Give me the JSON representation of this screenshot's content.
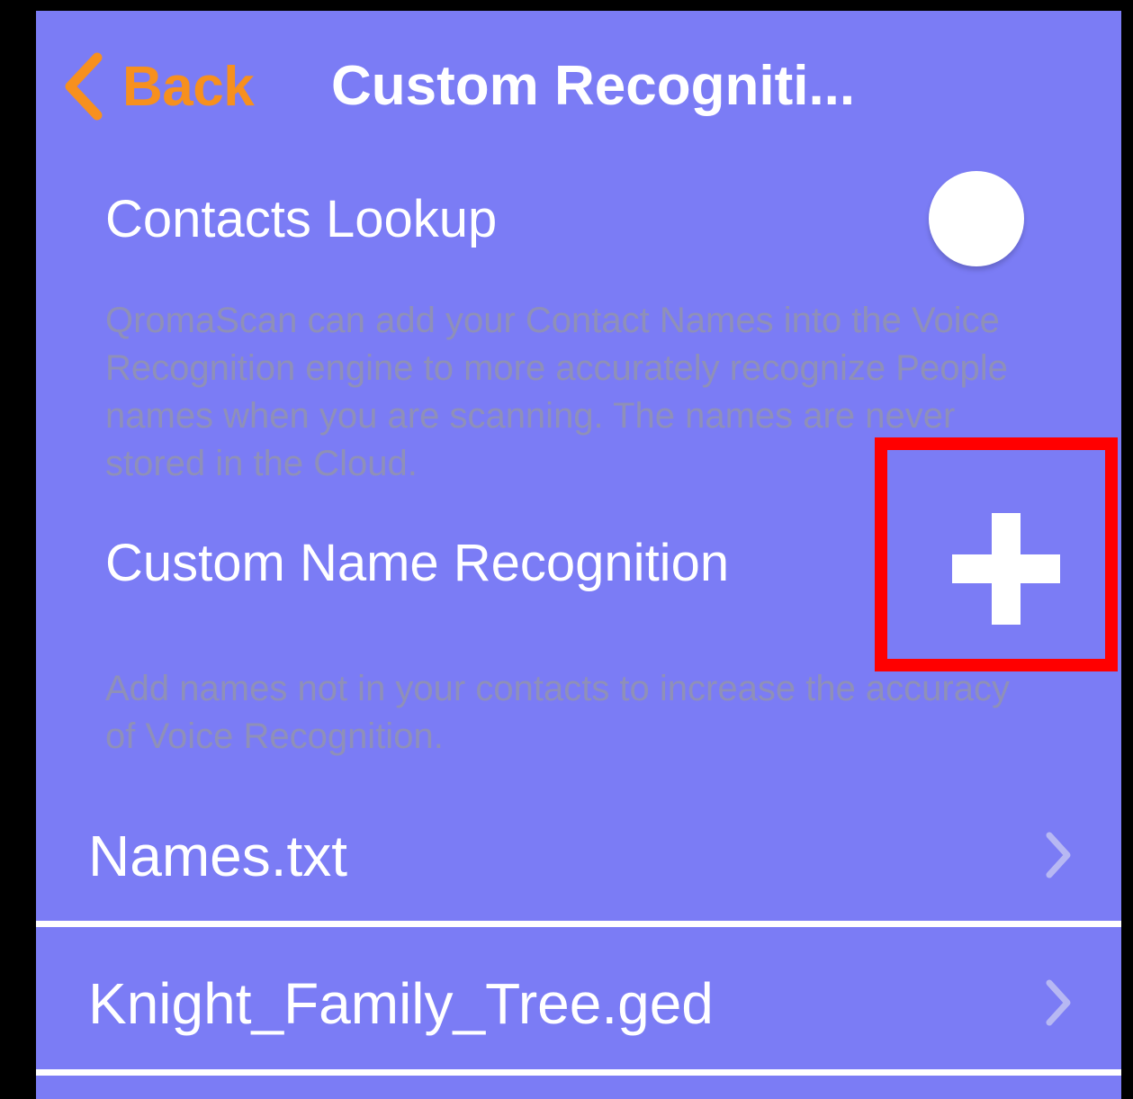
{
  "nav": {
    "back_label": "Back",
    "title": "Custom Recogniti..."
  },
  "contacts_lookup": {
    "label": "Contacts Lookup",
    "toggle_state": "off",
    "description": "QromaScan can add your Contact Names into the Voice Recognition engine to more accurately recognize People names when you are scanning. The names are never stored in the Cloud."
  },
  "custom_name_recognition": {
    "label": "Custom Name Recognition",
    "add_icon": "plus-icon",
    "description": "Add names not in your contacts to increase the accuracy of Voice Recognition."
  },
  "files": [
    {
      "name": "Names.txt",
      "icon": "chevron-right-icon"
    },
    {
      "name": "Knight_Family_Tree.ged",
      "icon": "chevron-right-icon"
    }
  ],
  "colors": {
    "background": "#7b7cf5",
    "accent": "#f7901e",
    "footer_text": "#8f90b8",
    "highlight": "#ff0000",
    "outer": "#000000"
  }
}
